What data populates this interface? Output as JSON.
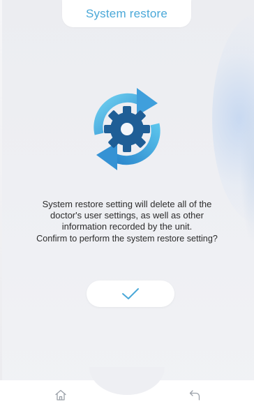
{
  "header": {
    "title": "System restore"
  },
  "message": {
    "line1": "System restore setting will delete all of the",
    "line2": "doctor's user settings, as well as other",
    "line3": "information recorded by the unit.",
    "question": "Confirm to perform the system restore setting?"
  },
  "icons": {
    "main": "system-restore-gear-icon",
    "confirm": "checkmark-icon",
    "home": "home-icon",
    "back": "back-arrow-icon"
  },
  "colors": {
    "accent": "#4aa8d8",
    "gear": "#1f5e96",
    "arrow_light": "#5cc6ec",
    "arrow_dark": "#2f8fd0",
    "background": "#eeeff3",
    "text": "#2b2b2b"
  }
}
